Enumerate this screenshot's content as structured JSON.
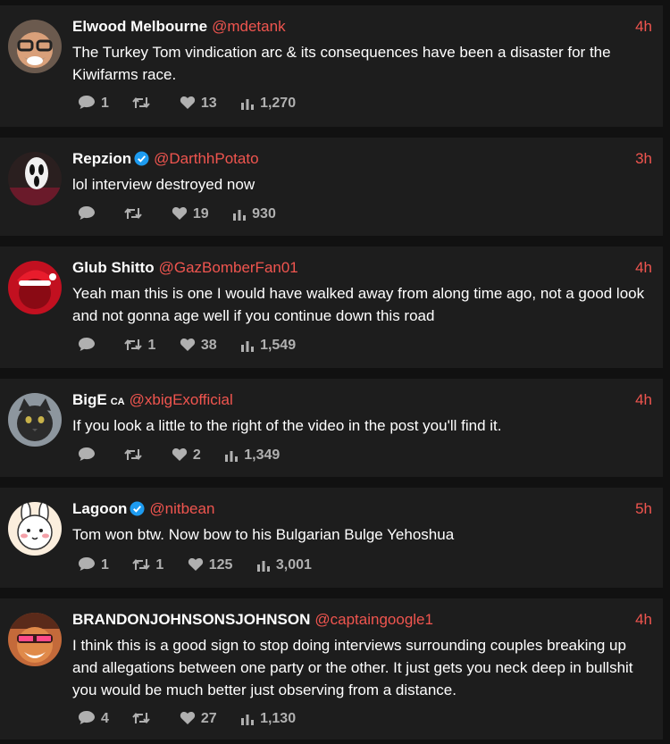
{
  "tweets": [
    {
      "name": "Elwood Melbourne",
      "verified": false,
      "country": "",
      "handle": "@mdetank",
      "time": "4h",
      "text": "The Turkey Tom vindication arc & its consequences have been a disaster for the Kiwifarms race.",
      "replies": "1",
      "retweets": "",
      "likes": "13",
      "views": "1,270"
    },
    {
      "name": "Repzion",
      "verified": true,
      "country": "",
      "handle": "@DarthhPotato",
      "time": "3h",
      "text": "lol interview destroyed now",
      "replies": "",
      "retweets": "",
      "likes": "19",
      "views": "930"
    },
    {
      "name": "Glub Shitto",
      "verified": false,
      "country": "",
      "handle": "@GazBomberFan01",
      "time": "4h",
      "text": "Yeah man this is one I would have walked away from along time ago, not a good look and not gonna age well if you continue down this road",
      "replies": "",
      "retweets": "1",
      "likes": "38",
      "views": "1,549"
    },
    {
      "name": "BigE",
      "verified": false,
      "country": "CA",
      "handle": "@xbigExofficial",
      "time": "4h",
      "text": "If you look a little to the right of the video in the post you'll find it.",
      "replies": "",
      "retweets": "",
      "likes": "2",
      "views": "1,349"
    },
    {
      "name": "Lagoon",
      "verified": true,
      "country": "",
      "handle": "@nitbean",
      "time": "5h",
      "text": "Tom won btw. Now bow to his Bulgarian Bulge Yehoshua",
      "replies": "1",
      "retweets": "1",
      "likes": "125",
      "views": "3,001"
    },
    {
      "name": "BRANDONJOHNSONSJOHNSON",
      "verified": false,
      "country": "",
      "handle": "@captaingoogle1",
      "time": "4h",
      "text": "I think this is a good sign to stop doing interviews surrounding couples breaking up and allegations between one party or the other. It just gets you neck deep in bullshit you would be much better just observing from a distance.",
      "replies": "4",
      "retweets": "",
      "likes": "27",
      "views": "1,130"
    }
  ],
  "colors": {
    "background": "#111111",
    "card": "#1d1d1d",
    "accent": "#f0554f",
    "text": "#ffffff",
    "muted": "#b0b0b0",
    "verified": "#1d9bf0"
  },
  "icons": {
    "reply": "reply-icon",
    "retweet": "retweet-icon",
    "like": "heart-icon",
    "views": "views-chart-icon",
    "verified": "verified-badge-icon"
  }
}
